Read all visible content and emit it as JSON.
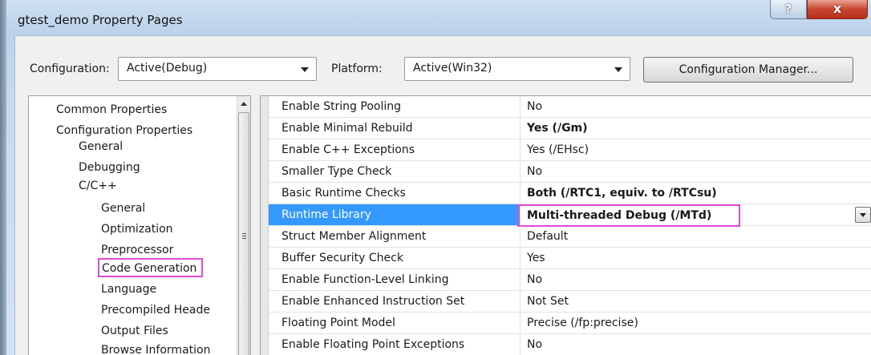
{
  "window": {
    "title": "gtest_demo Property Pages",
    "help_label": "?",
    "close_label": "x"
  },
  "toolbar": {
    "configuration_label": "Configuration:",
    "configuration_value": "Active(Debug)",
    "platform_label": "Platform:",
    "platform_value": "Active(Win32)",
    "config_manager_label": "Configuration Manager..."
  },
  "tree": {
    "items": [
      {
        "label": "Common Properties"
      },
      {
        "label": "Configuration Properties"
      },
      {
        "label": "General"
      },
      {
        "label": "Debugging"
      },
      {
        "label": "C/C++"
      },
      {
        "label": "General"
      },
      {
        "label": "Optimization"
      },
      {
        "label": "Preprocessor"
      },
      {
        "label": "Code Generation"
      },
      {
        "label": "Language"
      },
      {
        "label": "Precompiled Heade"
      },
      {
        "label": "Output Files"
      },
      {
        "label": "Browse Information"
      }
    ],
    "selected_index": 8
  },
  "properties": {
    "rows": [
      {
        "name": "Enable String Pooling",
        "value": "No"
      },
      {
        "name": "Enable Minimal Rebuild",
        "value": "Yes (/Gm)"
      },
      {
        "name": "Enable C++ Exceptions",
        "value": "Yes (/EHsc)"
      },
      {
        "name": "Smaller Type Check",
        "value": "No"
      },
      {
        "name": "Basic Runtime Checks",
        "value": "Both (/RTC1, equiv. to /RTCsu)"
      },
      {
        "name": "Runtime Library",
        "value": "Multi-threaded Debug (/MTd)"
      },
      {
        "name": "Struct Member Alignment",
        "value": "Default"
      },
      {
        "name": "Buffer Security Check",
        "value": "Yes"
      },
      {
        "name": "Enable Function-Level Linking",
        "value": "No"
      },
      {
        "name": "Enable Enhanced Instruction Set",
        "value": "Not Set"
      },
      {
        "name": "Floating Point Model",
        "value": "Precise (/fp:precise)"
      },
      {
        "name": "Enable Floating Point Exceptions",
        "value": "No"
      }
    ],
    "selected_index": 5
  },
  "colors": {
    "selection": "#3399ff",
    "highlight_annotation": "#e04ad8",
    "close_button": "#c8452f"
  }
}
